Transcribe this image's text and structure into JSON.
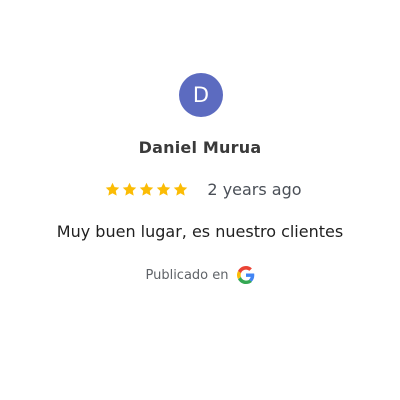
{
  "review": {
    "avatar_initial": "D",
    "reviewer_name": "Daniel Murua",
    "rating": 5,
    "rating_max": 5,
    "time_ago": "2 years ago",
    "text": "Muy buen lugar, es nuestro clientes",
    "published_label": "Publicado en",
    "source_icon": "google-g-icon"
  },
  "colors": {
    "avatar_bg": "#5c6bc0",
    "star": "#fbbc05",
    "google_blue": "#4285f4",
    "google_red": "#ea4335",
    "google_yellow": "#fbbc05",
    "google_green": "#34a853"
  }
}
